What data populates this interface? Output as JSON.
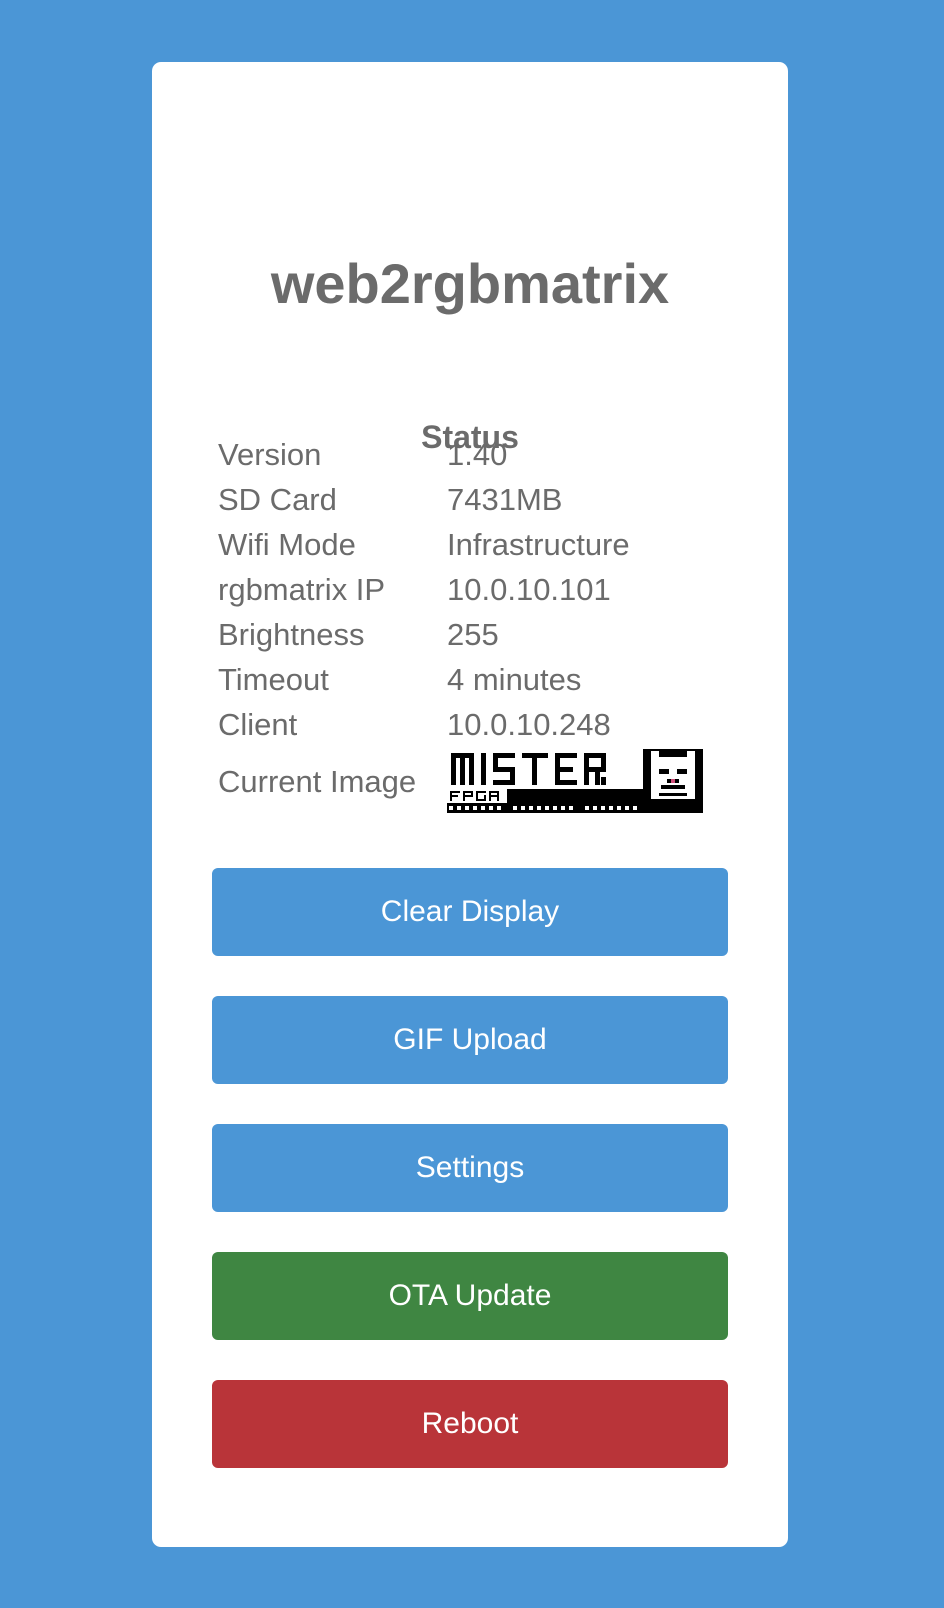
{
  "app": {
    "title": "web2rgbmatrix"
  },
  "status": {
    "heading": "Status",
    "rows": [
      {
        "label": "Version",
        "value": "1.40"
      },
      {
        "label": "SD Card",
        "value": "7431MB"
      },
      {
        "label": "Wifi Mode",
        "value": "Infrastructure"
      },
      {
        "label": "rgbmatrix IP",
        "value": "10.0.10.101"
      },
      {
        "label": "Brightness",
        "value": "255"
      },
      {
        "label": "Timeout",
        "value": "4 minutes"
      },
      {
        "label": "Client",
        "value": "10.0.10.248"
      }
    ],
    "current_image_label": "Current Image",
    "current_image_logo_text": "MiSTer FPGA"
  },
  "buttons": {
    "clear_display": "Clear Display",
    "gif_upload": "GIF Upload",
    "settings": "Settings",
    "ota_update": "OTA Update",
    "reboot": "Reboot"
  },
  "colors": {
    "background": "#4b96d6",
    "primary_button": "#4b96d6",
    "ota_button": "#3f8642",
    "reboot_button": "#b93439",
    "text": "#6b6b6b"
  }
}
